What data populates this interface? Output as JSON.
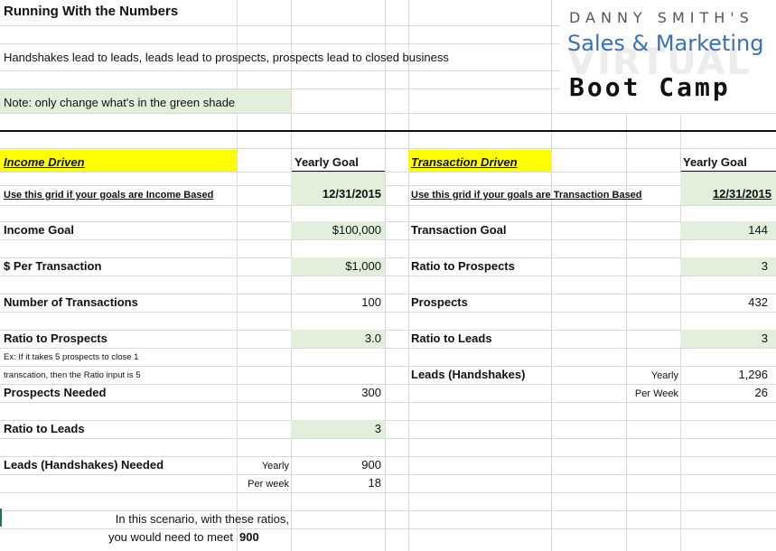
{
  "header": {
    "title": "Running With the Numbers",
    "tagline": "Handshakes lead to leads, leads lead to prospects, prospects lead to closed business",
    "note": "Note: only change what's in the green shade"
  },
  "logo": {
    "line1": "DANNY SMITH'S",
    "line2": "Sales & Marketing",
    "line3": "VIRTUAL",
    "line4": "Boot Camp"
  },
  "income": {
    "section_title": "Income Driven",
    "col_header": "Yearly Goal",
    "instruction": "Use this grid if your goals are Income Based",
    "date": "12/31/2015",
    "income_goal_label": "Income Goal",
    "income_goal_value": "$100,000",
    "per_transaction_label": "$ Per Transaction",
    "per_transaction_value": "$1,000",
    "num_transactions_label": "Number of Transactions",
    "num_transactions_value": "100",
    "ratio_prospects_label": "Ratio to Prospects",
    "ratio_prospects_value": "3.0",
    "example_line1": "Ex: If it takes 5 prospects to close 1",
    "example_line2": "transcation, then the Ratio input is 5",
    "prospects_needed_label": "Prospects Needed",
    "prospects_needed_value": "300",
    "ratio_leads_label": "Ratio to Leads",
    "ratio_leads_value": "3",
    "leads_needed_label": "Leads (Handshakes) Needed",
    "yearly_label": "Yearly",
    "yearly_value": "900",
    "per_week_label": "Per week",
    "per_week_value": "18",
    "scenario_line1": "In this scenario, with these ratios,",
    "scenario_line2": "you would need to meet",
    "scenario_value": "900"
  },
  "transaction": {
    "section_title": "Transaction Driven",
    "col_header": "Yearly Goal",
    "instruction": "Use this grid if your goals are Transaction Based",
    "date": "12/31/2015",
    "goal_label": "Transaction Goal",
    "goal_value": "144",
    "ratio_prospects_label": "Ratio to Prospects",
    "ratio_prospects_value": "3",
    "prospects_label": "Prospects",
    "prospects_value": "432",
    "ratio_leads_label": "Ratio to Leads",
    "ratio_leads_value": "3",
    "leads_label": "Leads (Handshakes)",
    "yearly_label": "Yearly",
    "yearly_value": "1,296",
    "per_week_label": "Per Week",
    "per_week_value": "26"
  },
  "colors": {
    "green_input": "#e2efda",
    "yellow_header": "#ffff00",
    "logo_blue": "#3b6fba"
  }
}
